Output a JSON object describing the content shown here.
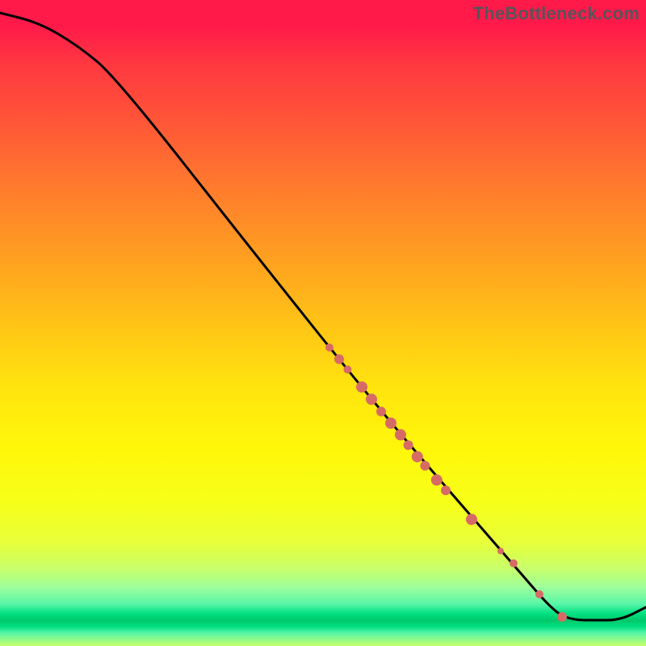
{
  "watermark": "TheBottleneck.com",
  "chart_data": {
    "type": "line",
    "title": "",
    "xlabel": "",
    "ylabel": "",
    "xlim": [
      0,
      100
    ],
    "ylim": [
      0,
      100
    ],
    "curve": [
      {
        "x": 0,
        "y": 98
      },
      {
        "x": 6,
        "y": 96.5
      },
      {
        "x": 12,
        "y": 93
      },
      {
        "x": 18,
        "y": 88
      },
      {
        "x": 40,
        "y": 60
      },
      {
        "x": 60,
        "y": 35
      },
      {
        "x": 80,
        "y": 12
      },
      {
        "x": 86,
        "y": 5
      },
      {
        "x": 89,
        "y": 4.0
      },
      {
        "x": 92,
        "y": 4.0
      },
      {
        "x": 96,
        "y": 4.0
      },
      {
        "x": 100,
        "y": 6
      }
    ],
    "points": [
      {
        "x": 51.0,
        "y": 46.2,
        "r": 5
      },
      {
        "x": 52.5,
        "y": 44.4,
        "r": 6
      },
      {
        "x": 53.8,
        "y": 42.8,
        "r": 5
      },
      {
        "x": 56.0,
        "y": 40.1,
        "r": 7
      },
      {
        "x": 57.5,
        "y": 38.2,
        "r": 7
      },
      {
        "x": 59.0,
        "y": 36.3,
        "r": 6
      },
      {
        "x": 60.5,
        "y": 34.5,
        "r": 7
      },
      {
        "x": 62.0,
        "y": 32.7,
        "r": 7
      },
      {
        "x": 63.2,
        "y": 31.1,
        "r": 6
      },
      {
        "x": 64.6,
        "y": 29.3,
        "r": 7
      },
      {
        "x": 65.8,
        "y": 27.9,
        "r": 6
      },
      {
        "x": 67.6,
        "y": 25.7,
        "r": 7
      },
      {
        "x": 69.0,
        "y": 24.1,
        "r": 6
      },
      {
        "x": 73.0,
        "y": 19.6,
        "r": 7
      },
      {
        "x": 77.5,
        "y": 14.7,
        "r": 4
      },
      {
        "x": 79.5,
        "y": 12.8,
        "r": 5
      },
      {
        "x": 83.5,
        "y": 8.0,
        "r": 5
      },
      {
        "x": 87.0,
        "y": 4.5,
        "r": 6
      }
    ],
    "colors": {
      "curve": "#000000",
      "points": "#d66b65"
    }
  }
}
